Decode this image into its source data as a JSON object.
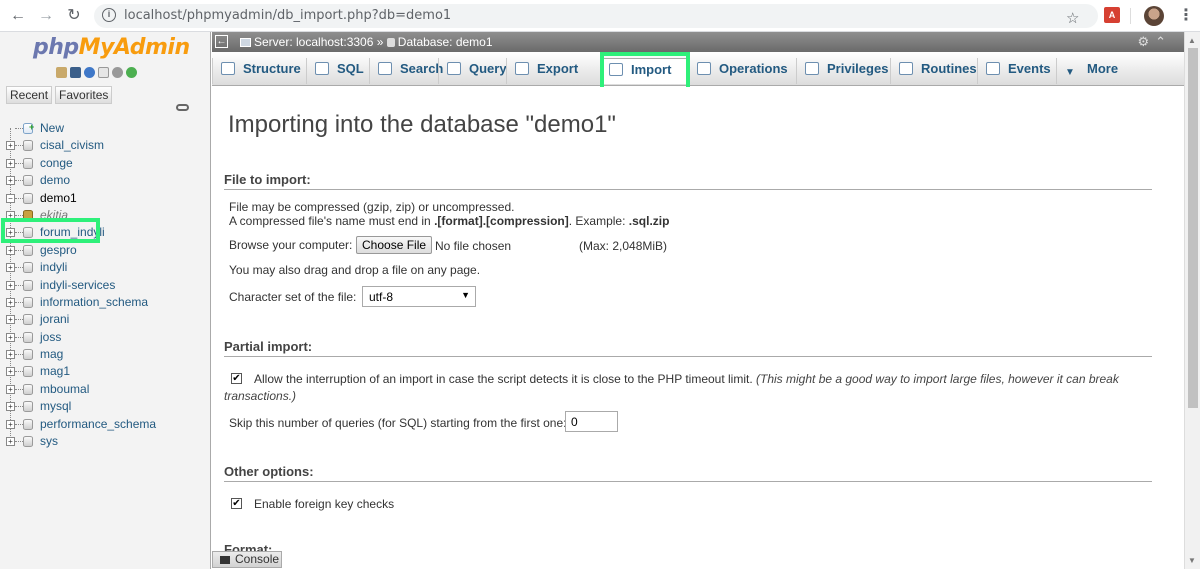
{
  "browser": {
    "url": "localhost/phpmyadmin/db_import.php?db=demo1",
    "back_icon": "arrow-left-icon",
    "forward_icon": "arrow-right-icon",
    "reload_icon": "reload-icon"
  },
  "sidebar": {
    "logo_php": "php",
    "logo_myadmin": "MyAdmin",
    "recent_label": "Recent",
    "favorites_label": "Favorites",
    "new_label": "New",
    "databases": [
      "cisal_civism",
      "conge",
      "demo",
      "demo1",
      "ekitia",
      "forum_indyli",
      "gespro",
      "indyli",
      "indyli-services",
      "information_schema",
      "jorani",
      "joss",
      "mag",
      "mag1",
      "mboumal",
      "mysql",
      "performance_schema",
      "sys"
    ],
    "selected_db": "demo1"
  },
  "breadcrumb": {
    "server": "Server: localhost:3306",
    "separator": "»",
    "database": "Database: demo1"
  },
  "tabs": [
    {
      "label": "Structure"
    },
    {
      "label": "SQL"
    },
    {
      "label": "Search"
    },
    {
      "label": "Query"
    },
    {
      "label": "Export"
    },
    {
      "label": "Import"
    },
    {
      "label": "Operations"
    },
    {
      "label": "Privileges"
    },
    {
      "label": "Routines"
    },
    {
      "label": "Events"
    },
    {
      "label": "More"
    }
  ],
  "active_tab": "Import",
  "highlight_color": "#2ef07a",
  "page": {
    "title": "Importing into the database \"demo1\"",
    "file_to_import": {
      "heading": "File to import:",
      "line1": "File may be compressed (gzip, zip) or uncompressed.",
      "line2_prefix": "A compressed file's name must end in ",
      "line2_format": ".[format].[compression]",
      "line2_mid": ". Example: ",
      "line2_example": ".sql.zip",
      "browse_label": "Browse your computer:",
      "choose_button": "Choose File",
      "no_file": "No file chosen",
      "max_size": "(Max: 2,048MiB)",
      "drag_hint": "You may also drag and drop a file on any page.",
      "charset_label": "Character set of the file:",
      "charset_value": "utf-8"
    },
    "partial_import": {
      "heading": "Partial import:",
      "allow_interrupt_checked": true,
      "allow_interrupt_text": "Allow the interruption of an import in case the script detects it is close to the PHP timeout limit.",
      "allow_interrupt_note": "(This might be a good way to import large files, however it can break transactions.)",
      "skip_label": "Skip this number of queries (for SQL) starting from the first one:",
      "skip_value": "0"
    },
    "other_options": {
      "heading": "Other options:",
      "fk_checks_checked": true,
      "fk_checks_label": "Enable foreign key checks"
    },
    "format_heading": "Format:"
  },
  "console_label": "Console"
}
